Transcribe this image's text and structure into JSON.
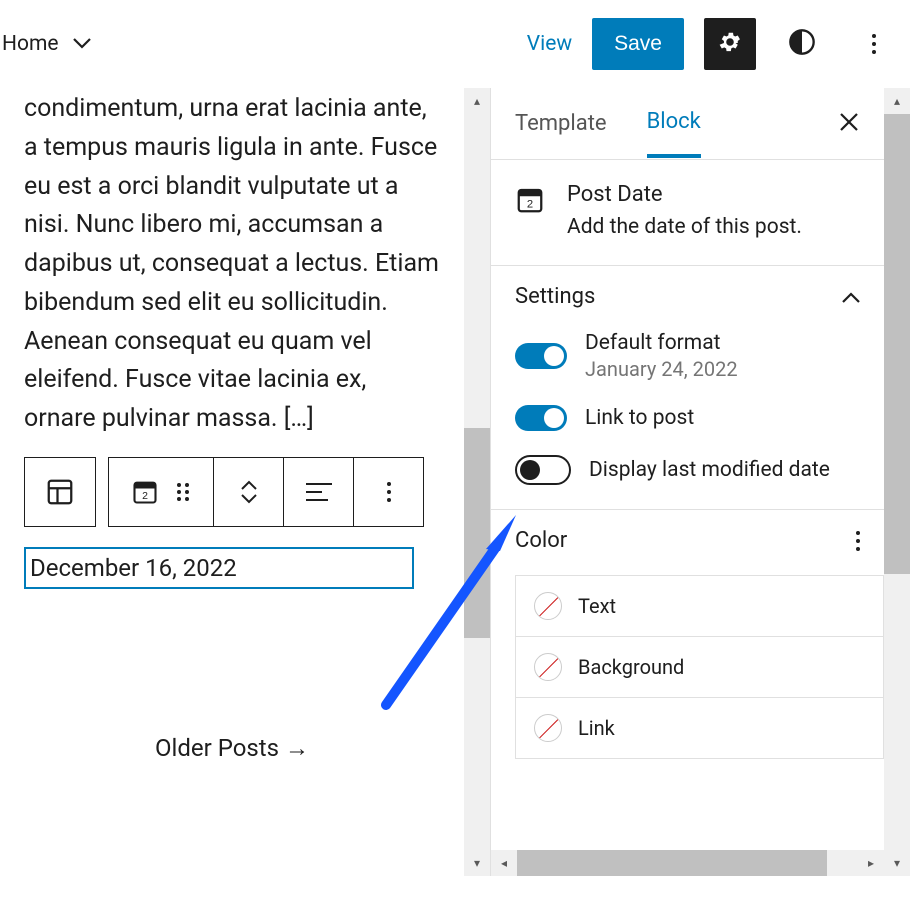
{
  "topbar": {
    "home": "Home",
    "view": "View",
    "save": "Save"
  },
  "editor": {
    "body_text": "condimentum, urna erat lacinia ante, a tempus mauris ligula in ante. Fusce eu est a orci blandit vulputate ut a nisi. Nunc libero mi, accumsan a dapibus ut, consequat a lectus. Etiam bibendum sed elit eu sollicitudin. Aenean consequat eu quam vel eleifend. Fusce vitae lacinia ex, ornare pulvinar massa. […]",
    "date_value": "December 16, 2022",
    "older_posts": "Older Posts  →"
  },
  "sidebar": {
    "tabs": {
      "template": "Template",
      "block": "Block"
    },
    "block_header": {
      "title": "Post Date",
      "desc": "Add the date of this post."
    },
    "settings": {
      "label": "Settings",
      "default_format": {
        "label": "Default format",
        "sub": "January 24, 2022"
      },
      "link_to_post": {
        "label": "Link to post"
      },
      "display_modified": {
        "label": "Display last modified date"
      }
    },
    "color": {
      "label": "Color",
      "rows": {
        "text": "Text",
        "background": "Background",
        "link": "Link"
      }
    }
  }
}
